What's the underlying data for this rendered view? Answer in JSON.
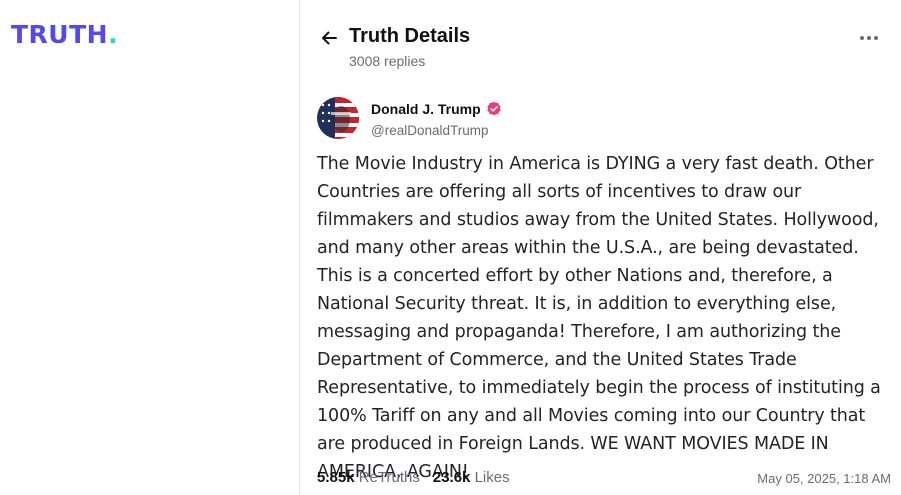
{
  "app": {
    "logo_text": "TRUTH",
    "logo_dot": ".",
    "brand_color": "#5448ee",
    "accent_color": "#17e2c7"
  },
  "header": {
    "back_icon": "arrow-left-icon",
    "title": "Truth Details",
    "subtitle": "3008 replies",
    "more_icon": "more-horizontal-icon"
  },
  "post": {
    "author_name": "Donald J. Trump",
    "verified_icon": "verified-badge-icon",
    "verified_color": "#ea3b7b",
    "handle": "@realDonaldTrump",
    "text": "The Movie Industry in America is DYING a very fast death. Other Countries are offering all sorts of incentives to draw our filmmakers and studios away from the United States. Hollywood, and many other areas within the U.S.A., are being devastated. This is a concerted effort by other Nations and, therefore, a National Security threat. It is, in addition to everything else, messaging and propaganda! Therefore, I am authorizing the Department of Commerce, and the United States Trade Representative, to immediately begin the process of instituting a 100% Tariff on any and all Movies coming into our Country that are produced in Foreign Lands. WE WANT MOVIES MADE IN AMERICA, AGAIN!",
    "retruths_count": "5.85k",
    "retruths_label": "ReTruths",
    "likes_count": "23.6k",
    "likes_label": "Likes",
    "timestamp": "May 05, 2025, 1:18 AM"
  }
}
